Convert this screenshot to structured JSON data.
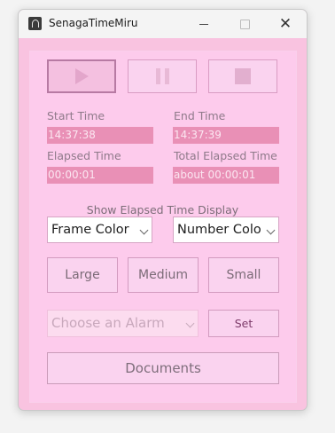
{
  "window": {
    "title": "SenagaTimeMiru",
    "close_glyph": "✕"
  },
  "controls": {
    "play_icon": "play-icon",
    "pause_icon": "pause-icon",
    "stop_icon": "stop-icon"
  },
  "times": {
    "start_label": "Start Time",
    "start_value": "14:37:38",
    "end_label": "End Time",
    "end_value": "14:37:39",
    "elapsed_label": "Elapsed Time",
    "elapsed_value": "00:00:01",
    "total_label": "Total Elapsed Time",
    "total_value": "about 00:00:01"
  },
  "display": {
    "section_title": "Show Elapsed Time Display",
    "frame_color": "Frame Color",
    "number_color": "Number Colo",
    "large": "Large",
    "medium": "Medium",
    "small": "Small"
  },
  "alarm": {
    "placeholder": "Choose an Alarm",
    "set_label": "Set"
  },
  "documents_label": "Documents",
  "colors": {
    "frame": "#f9c3e0",
    "panel": "#fdcbec",
    "value_box": "#e990b6"
  }
}
